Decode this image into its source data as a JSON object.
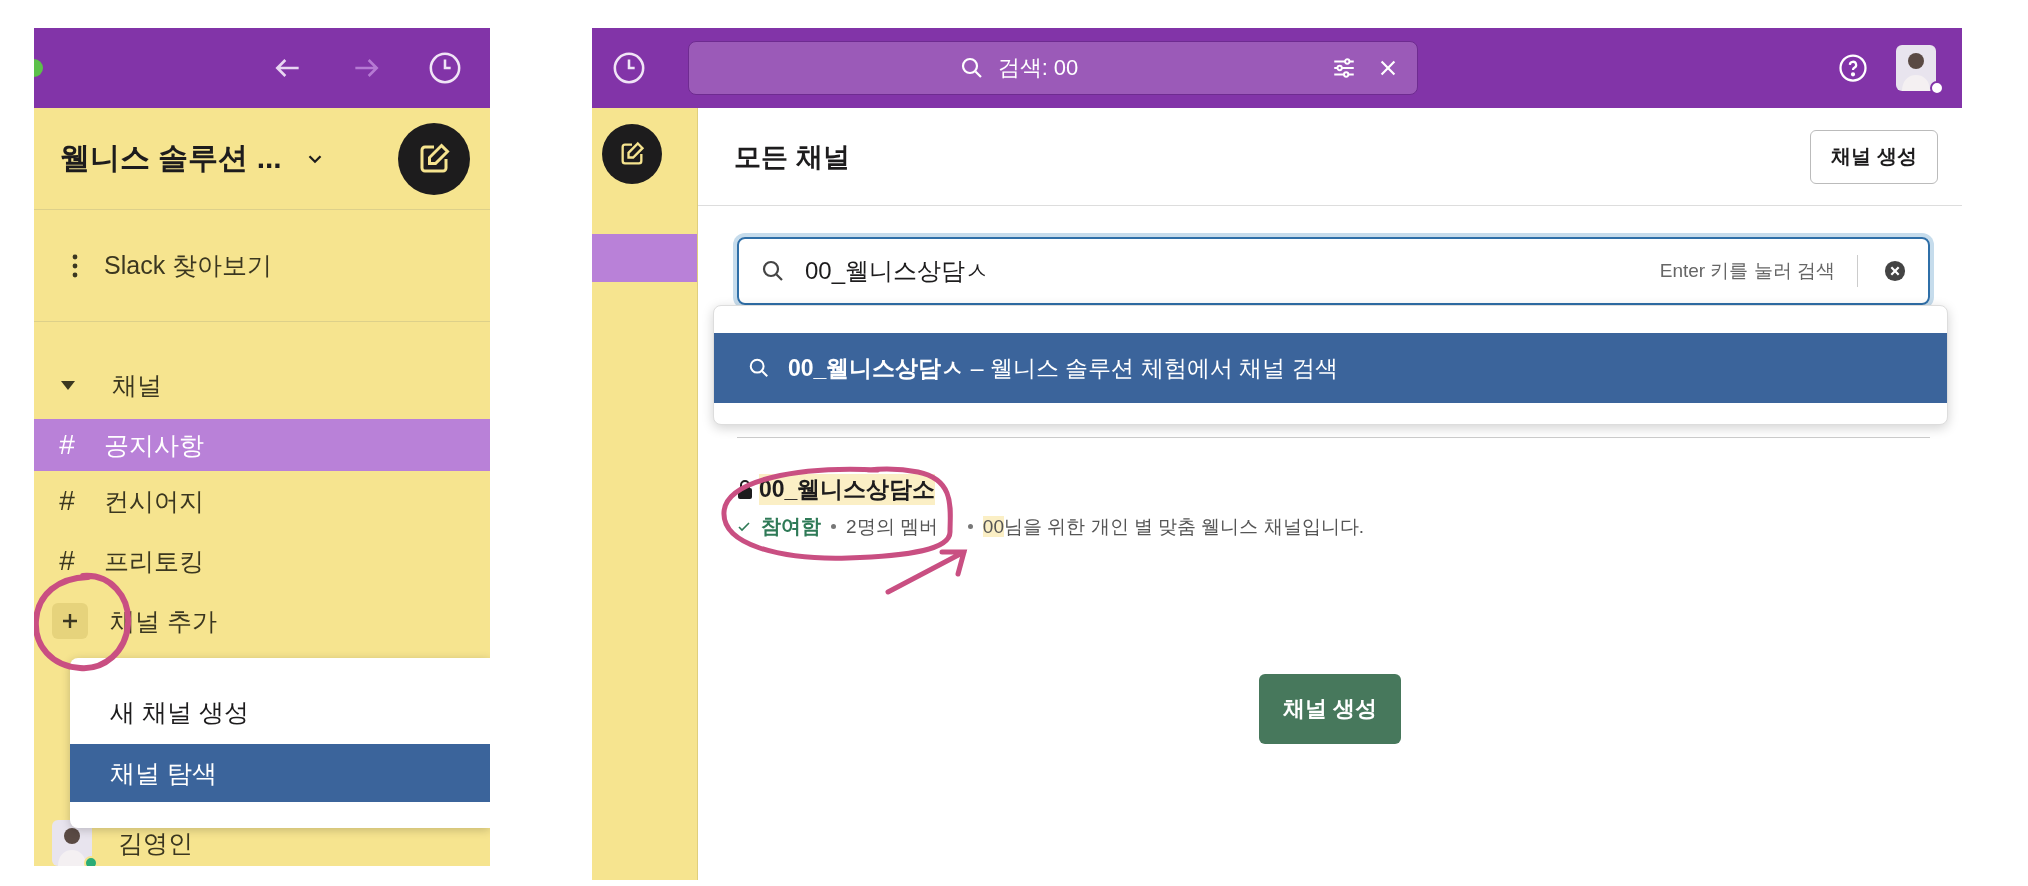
{
  "left": {
    "workspace": {
      "name": "웰니스 솔루션 ..."
    },
    "browse": "Slack 찾아보기",
    "section": {
      "label": "채널",
      "expanded": true
    },
    "channels": [
      {
        "icon": "#",
        "name": "공지사항",
        "selected": true
      },
      {
        "icon": "#",
        "name": "컨시어지",
        "selected": false
      },
      {
        "icon": "#",
        "name": "프리토킹",
        "selected": false
      }
    ],
    "add_channel": "채널 추가",
    "menu": [
      {
        "label": "새 채널 생성",
        "selected": false
      },
      {
        "label": "채널 탐색",
        "selected": true
      }
    ],
    "members": [
      {
        "name": "김영인",
        "online": true
      }
    ]
  },
  "right": {
    "search_pill": {
      "value": "검색: 00"
    },
    "title": "모든 채널",
    "create_button": "채널 생성",
    "search": {
      "value": "00_웰니스상담ㅅ",
      "hint": "Enter 키를 눌러 검색"
    },
    "suggestions": [
      {
        "text": "**00_웰니스상담ㅅ** – 웰니스 솔루션 체험에서 채널 검색",
        "selected": true
      }
    ],
    "results": [
      {
        "name": "00_웰니스상담소",
        "private": true,
        "joined": true,
        "status": "참여함",
        "members": "2명의 멤버",
        "match": "00",
        "rest": "님을 위한 개인 별 맞춤 웰니스 채널입니다."
      }
    ],
    "empty_button": "채널 생성"
  }
}
